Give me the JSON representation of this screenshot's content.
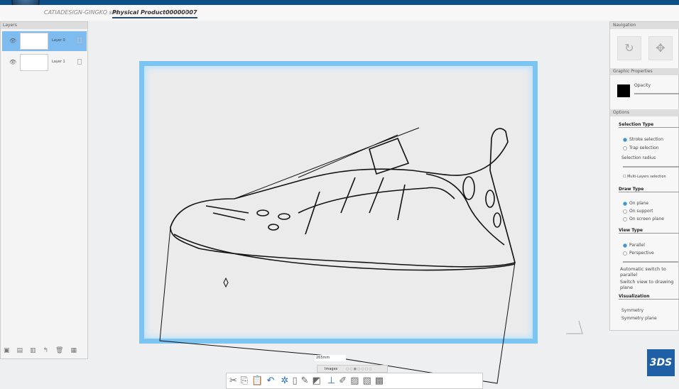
{
  "tabs": {
    "session": "CATIADESIGN-GINGKO snc",
    "active": "Physical Product00000007",
    "add": "+"
  },
  "layers": {
    "title": "Layers",
    "items": [
      {
        "name": "Layer 0",
        "selected": true
      },
      {
        "name": "Layer 1",
        "selected": false
      }
    ]
  },
  "right": {
    "navigation": "Navigation",
    "graphic": "Graphic Properties",
    "opacity": "Opacity",
    "swatch_color": "#000000",
    "options": "Options",
    "selection_type": "Selection Type",
    "stroke": "Stroke selection",
    "trap": "Trap selection",
    "radius": "Selection radius",
    "multi": "Multi-Layers selection",
    "draw_type": "Draw Type",
    "on_plane": "On plane",
    "on_support": "On support",
    "on_screen": "On screen plane",
    "view_type": "View Type",
    "parallel": "Parallel",
    "perspective": "Perspective",
    "auto_switch": "Automatic switch to parallel",
    "switch_view": "Switch view to drawing plane",
    "visualization": "Visualization",
    "symmetry": "Symmetry",
    "symmetry_plane": "Symmetry plane"
  },
  "images": {
    "label": "Images",
    "dots": "○○●○○○○",
    "measure": "265mm"
  },
  "logo": "3DS"
}
